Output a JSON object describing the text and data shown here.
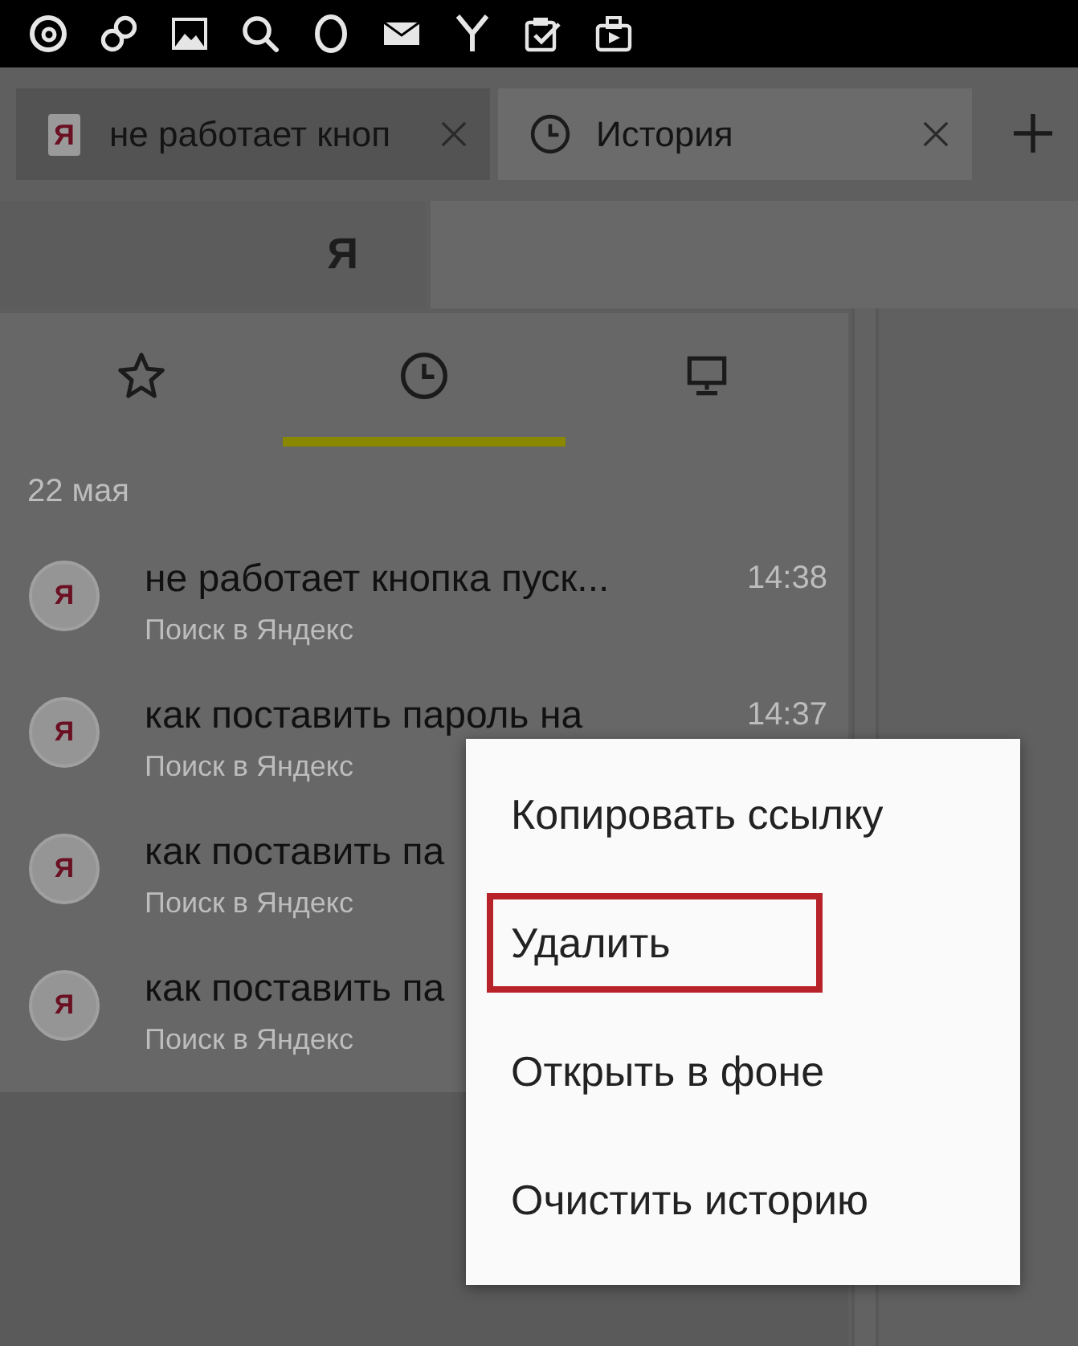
{
  "tabs": [
    {
      "kind": "page",
      "favicon": "Я",
      "title": "не работает кноп",
      "selected": false
    },
    {
      "kind": "history",
      "title": "История",
      "selected": true
    }
  ],
  "toolbar": {
    "logo": "Я"
  },
  "panel": {
    "tabs": [
      {
        "kind": "bookmarks",
        "selected": false
      },
      {
        "kind": "history",
        "selected": true
      },
      {
        "kind": "devices",
        "selected": false
      }
    ],
    "date": "22 мая",
    "items": [
      {
        "favicon": "Я",
        "title": "не работает кнопка пуск...",
        "source": "Поиск в Яндекс",
        "time": "14:38"
      },
      {
        "favicon": "Я",
        "title": "как поставить пароль на",
        "source": "Поиск в Яндекс",
        "time": "14:37"
      },
      {
        "favicon": "Я",
        "title": "как поставить па",
        "source": "Поиск в Яндекс"
      },
      {
        "favicon": "Я",
        "title": "как поставить па",
        "source": "Поиск в Яндекс"
      }
    ]
  },
  "context_menu": {
    "items": [
      {
        "label": "Копировать ссылку",
        "highlighted": false
      },
      {
        "label": "Удалить",
        "highlighted": true
      },
      {
        "label": "Открыть в фоне",
        "highlighted": false
      },
      {
        "label": "Очистить историю",
        "highlighted": false
      }
    ]
  }
}
